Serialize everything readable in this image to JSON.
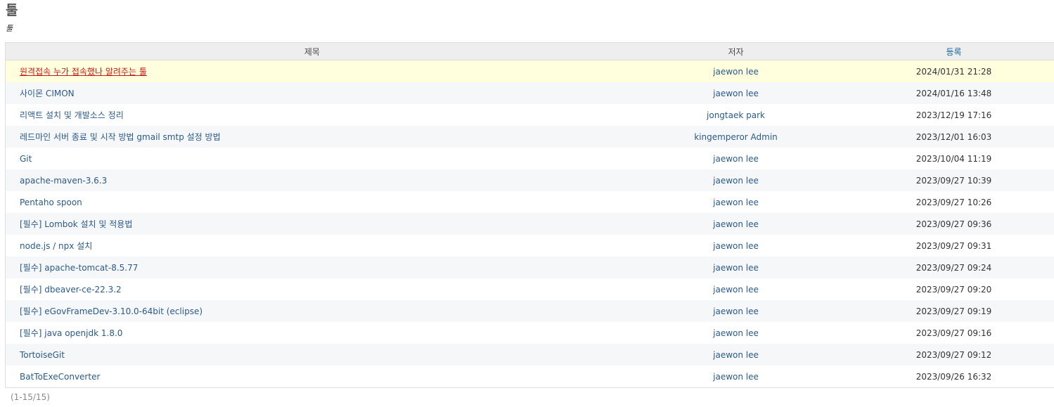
{
  "page": {
    "title": "툴",
    "description": "툴"
  },
  "table": {
    "headers": {
      "title": "제목",
      "author": "저자",
      "date": "등록"
    },
    "rows": [
      {
        "title": "원격접속 누가 접속했나 알려주는 툴",
        "author": "jaewon lee",
        "date": "2024/01/31 21:28"
      },
      {
        "title": "사이몬 CIMON",
        "author": "jaewon lee",
        "date": "2024/01/16 13:48"
      },
      {
        "title": "리액트 설치 및 개발소스 정리",
        "author": "jongtaek park",
        "date": "2023/12/19 17:16"
      },
      {
        "title": "레드마인 서버 종료 및 시작 방법 gmail smtp 설정 방법",
        "author": "kingemperor Admin",
        "date": "2023/12/01 16:03"
      },
      {
        "title": "Git",
        "author": "jaewon lee",
        "date": "2023/10/04 11:19"
      },
      {
        "title": "apache-maven-3.6.3",
        "author": "jaewon lee",
        "date": "2023/09/27 10:39"
      },
      {
        "title": "Pentaho spoon",
        "author": "jaewon lee",
        "date": "2023/09/27 10:26"
      },
      {
        "title": "[필수] Lombok 설치 및 적용법",
        "author": "jaewon lee",
        "date": "2023/09/27 09:36"
      },
      {
        "title": "node.js / npx 설치",
        "author": "jaewon lee",
        "date": "2023/09/27 09:31"
      },
      {
        "title": "[필수] apache-tomcat-8.5.77",
        "author": "jaewon lee",
        "date": "2023/09/27 09:24"
      },
      {
        "title": "[필수] dbeaver-ce-22.3.2",
        "author": "jaewon lee",
        "date": "2023/09/27 09:20"
      },
      {
        "title": "[필수] eGovFrameDev-3.10.0-64bit (eclipse)",
        "author": "jaewon lee",
        "date": "2023/09/27 09:19"
      },
      {
        "title": "[필수] java openjdk 1.8.0",
        "author": "jaewon lee",
        "date": "2023/09/27 09:16"
      },
      {
        "title": "TortoiseGit",
        "author": "jaewon lee",
        "date": "2023/09/27 09:12"
      },
      {
        "title": "BatToExeConverter",
        "author": "jaewon lee",
        "date": "2023/09/26 16:32"
      }
    ]
  },
  "pagination": {
    "summary": "(1-15/15)"
  },
  "colors": {
    "link": "#2a5a8a",
    "link_hover": "#c61a1a",
    "row_hover_bg": "#ffffdd",
    "row_odd_bg": "#f6f7f8",
    "header_bg": "#eeeeee"
  }
}
